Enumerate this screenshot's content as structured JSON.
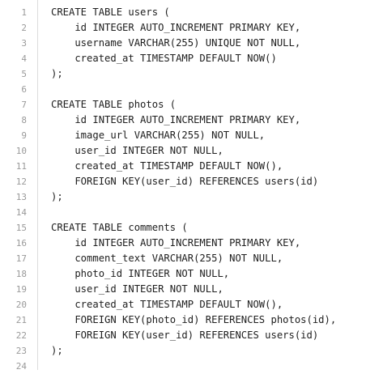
{
  "editor": {
    "lines": [
      {
        "number": "1",
        "text": "CREATE TABLE users ("
      },
      {
        "number": "2",
        "text": "    id INTEGER AUTO_INCREMENT PRIMARY KEY,"
      },
      {
        "number": "3",
        "text": "    username VARCHAR(255) UNIQUE NOT NULL,"
      },
      {
        "number": "4",
        "text": "    created_at TIMESTAMP DEFAULT NOW()"
      },
      {
        "number": "5",
        "text": ");"
      },
      {
        "number": "6",
        "text": ""
      },
      {
        "number": "7",
        "text": "CREATE TABLE photos ("
      },
      {
        "number": "8",
        "text": "    id INTEGER AUTO_INCREMENT PRIMARY KEY,"
      },
      {
        "number": "9",
        "text": "    image_url VARCHAR(255) NOT NULL,"
      },
      {
        "number": "10",
        "text": "    user_id INTEGER NOT NULL,"
      },
      {
        "number": "11",
        "text": "    created_at TIMESTAMP DEFAULT NOW(),"
      },
      {
        "number": "12",
        "text": "    FOREIGN KEY(user_id) REFERENCES users(id)"
      },
      {
        "number": "13",
        "text": ");"
      },
      {
        "number": "14",
        "text": ""
      },
      {
        "number": "15",
        "text": "CREATE TABLE comments ("
      },
      {
        "number": "16",
        "text": "    id INTEGER AUTO_INCREMENT PRIMARY KEY,"
      },
      {
        "number": "17",
        "text": "    comment_text VARCHAR(255) NOT NULL,"
      },
      {
        "number": "18",
        "text": "    photo_id INTEGER NOT NULL,"
      },
      {
        "number": "19",
        "text": "    user_id INTEGER NOT NULL,"
      },
      {
        "number": "20",
        "text": "    created_at TIMESTAMP DEFAULT NOW(),"
      },
      {
        "number": "21",
        "text": "    FOREIGN KEY(photo_id) REFERENCES photos(id),"
      },
      {
        "number": "22",
        "text": "    FOREIGN KEY(user_id) REFERENCES users(id)"
      },
      {
        "number": "23",
        "text": ");"
      },
      {
        "number": "24",
        "text": ""
      }
    ]
  }
}
